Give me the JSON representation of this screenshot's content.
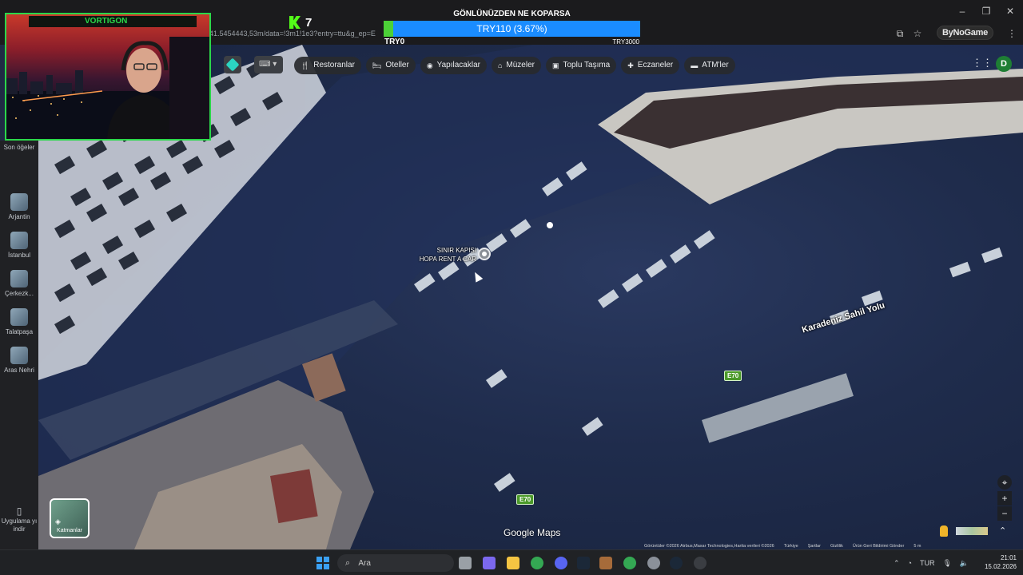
{
  "browser": {
    "url_fragment": "41.5454443,53m/data=!3m1!1e3?entry=ttu&g_ep=E",
    "profile_label": "ByNoGame"
  },
  "stream": {
    "cam_tab_title": "VORTIGON",
    "viewer_count": "7",
    "donation": {
      "title": "GÖNLÜNÜZDEN NE KOPARSA",
      "progress_label": "TRY110 (3.67%)",
      "progress_fraction": 0.0367,
      "min_label": "TRY0",
      "max_label": "TRY3000"
    }
  },
  "maps": {
    "chips": [
      {
        "icon": "fork-knife-icon",
        "glyph": "🍴",
        "label": "Restoranlar"
      },
      {
        "icon": "bed-icon",
        "glyph": "🛏",
        "label": "Oteller"
      },
      {
        "icon": "camera-icon",
        "glyph": "◉",
        "label": "Yapılacaklar"
      },
      {
        "icon": "museum-icon",
        "glyph": "⌂",
        "label": "Müzeler"
      },
      {
        "icon": "transit-icon",
        "glyph": "▣",
        "label": "Toplu Taşıma"
      },
      {
        "icon": "pharmacy-icon",
        "glyph": "✚",
        "label": "Eczaneler"
      },
      {
        "icon": "atm-icon",
        "glyph": "▬",
        "label": "ATM'ler"
      }
    ],
    "account_initial": "D",
    "rail": [
      {
        "label": "Son öğeler"
      },
      {
        "label": "Arjantin"
      },
      {
        "label": "İstanbul"
      },
      {
        "label": "Çerkezk..."
      },
      {
        "label": "Talatpaşa"
      },
      {
        "label": "Aras Nehri"
      }
    ],
    "download_app_label": "Uygulama yı indir",
    "layers_label": "Katmanlar",
    "poi": {
      "line1": "SINIR KAPISI",
      "line2": "HOPA RENT A CAR"
    },
    "road_label": "Karadeniz Sahil Yolu",
    "route_shield": "E70",
    "logo_text": "Google Maps",
    "attribution": {
      "imagery": "Görüntüler ©2026 Airbus,Maxar Technologies,Harita verileri ©2026",
      "country": "Türkiye",
      "terms": "Şartlar",
      "privacy": "Gizlilik",
      "feedback": "Ürün Geri Bildirimi Gönder",
      "scale": "5 m"
    }
  },
  "taskbar": {
    "search_placeholder": "Ara",
    "language": "TUR",
    "time": "21:01",
    "date": "15.02.2026"
  }
}
